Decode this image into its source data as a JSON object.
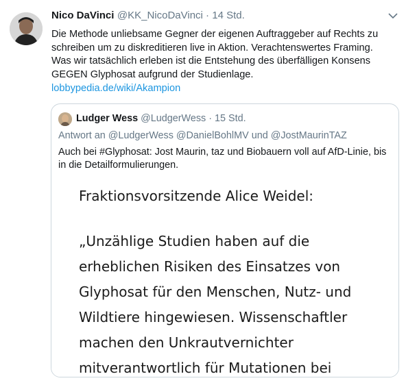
{
  "tweet": {
    "author_name": "Nico DaVinci",
    "handle": "@KK_NicoDaVinci",
    "separator": " · ",
    "time": "14 Std.",
    "text": "Die Methode unliebsame Gegner der eigenen Auftraggeber auf Rechts zu schreiben um zu diskreditieren live in Aktion. Verachtenswertes Framing. Was wir tatsächlich erleben ist die Entstehung des überfälligen Konsens GEGEN Glyphosat aufgrund der Studienlage.",
    "link": "lobbypedia.de/wiki/Akampion",
    "menu_icon": "chevron-down-icon"
  },
  "quote": {
    "author_name": "Ludger Wess",
    "handle": "@LudgerWess",
    "separator": " · ",
    "time": "15 Std.",
    "reply_to": "Antwort an @LudgerWess @DanielBohlMV und @JostMaurinTAZ",
    "text": "Auch bei #Glyphosat: Jost Maurin, taz und Biobauern voll auf AfD-Linie, bis in die Detailformulierungen.",
    "image": {
      "heading": "Fraktionsvorsitzende Alice Weidel:",
      "lines": [
        "„Unzählige Studien haben auf die",
        "erheblichen Risiken des Einsatzes von",
        "Glyphosat für den Menschen, Nutz- und",
        "Wildtiere hingewiesen. Wissenschaftler",
        "machen den Unkrautvernichter",
        "mitverantwortlich für Mutationen bei"
      ]
    }
  },
  "colors": {
    "text": "#14171a",
    "secondary": "#657786",
    "link": "#1b95e0",
    "border": "#ccd6dd"
  }
}
